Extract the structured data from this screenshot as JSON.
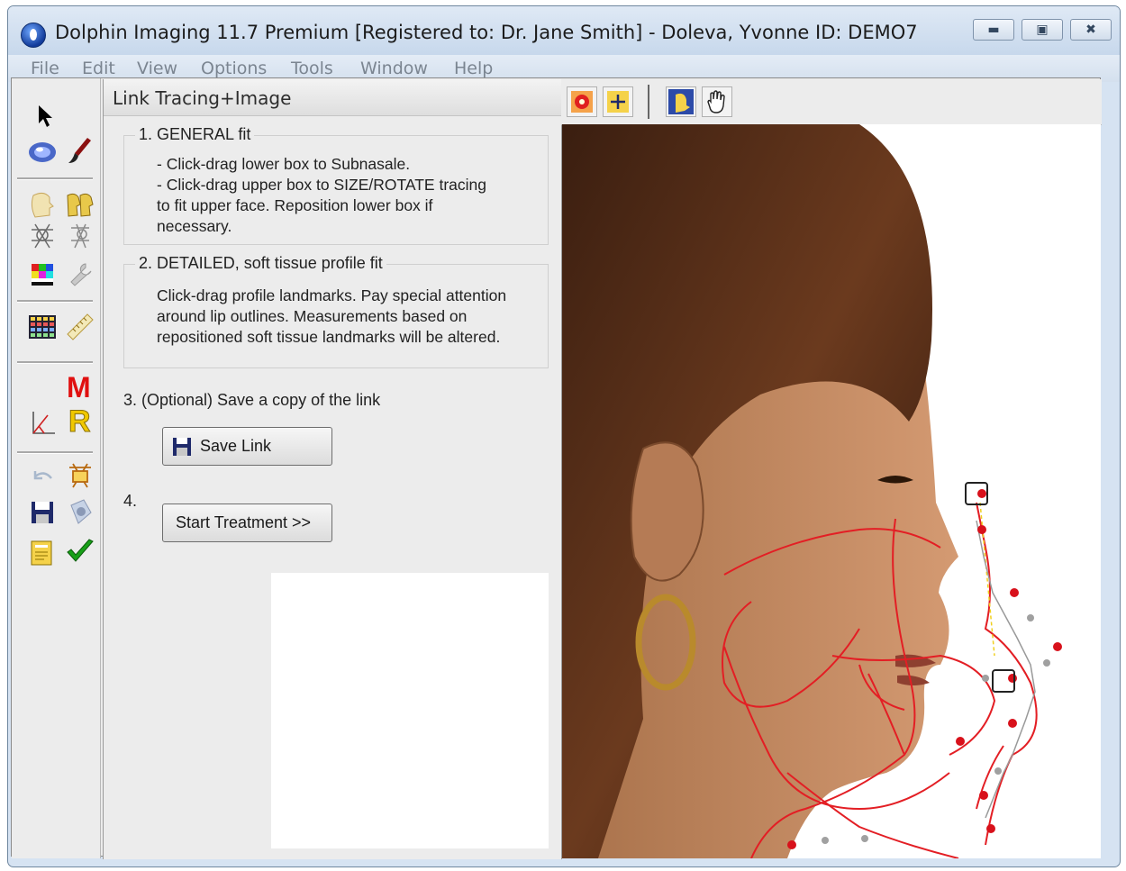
{
  "window": {
    "title": "Dolphin Imaging 11.7 Premium [Registered to: Dr. Jane Smith] - Doleva, Yvonne  ID: DEMO7",
    "controls": [
      "minimize-icon",
      "maximize-icon",
      "close-icon"
    ]
  },
  "menu": {
    "items": [
      "File",
      "Edit",
      "View",
      "Options",
      "Tools",
      "Window",
      "Help"
    ]
  },
  "left_toolbar": {
    "icons": [
      "arrow-pointer-icon",
      "lens-icon",
      "brush-icon",
      "face-profile-icon",
      "double-profile-icon",
      "tracing-skeleton-icon",
      "tracing-outline-icon",
      "color-palette-icon",
      "wrench-icon",
      "grid-icon",
      "ruler-icon",
      "m-icon",
      "analysis-icon",
      "r-icon",
      "undo-icon",
      "template-icon",
      "save-icon",
      "clear-icon",
      "notebook-icon",
      "checkmark-icon"
    ],
    "letters": {
      "m": "M",
      "r": "R"
    },
    "colors": {
      "m": "#e01010",
      "r": "#f0c800",
      "check": "#18a018"
    }
  },
  "panel": {
    "title": "Link Tracing+Image",
    "step1": {
      "heading": "1. GENERAL fit",
      "lines": [
        "- Click-drag lower box to Subnasale.",
        "- Click-drag upper box to SIZE/ROTATE tracing",
        "to fit upper face. Reposition lower box if",
        "necessary."
      ]
    },
    "step2": {
      "heading": "2. DETAILED, soft tissue profile fit",
      "lines": [
        "Click-drag profile landmarks. Pay special attention",
        "around lip outlines. Measurements based on",
        "repositioned soft tissue landmarks will be altered."
      ]
    },
    "step3": {
      "label": "3. (Optional) Save a copy of the link",
      "button": "Save Link"
    },
    "step4": {
      "label": "4.",
      "button": "Start Treatment >>"
    }
  },
  "top_toolbar": {
    "icons": [
      "target-icon",
      "resize-icon",
      "profile-portrait-icon",
      "hand-pan-icon"
    ]
  },
  "canvas": {
    "tracing_color": "#e31e24",
    "landmark_color": "#d8111b",
    "midpoint_color": "#a0a0a0"
  }
}
